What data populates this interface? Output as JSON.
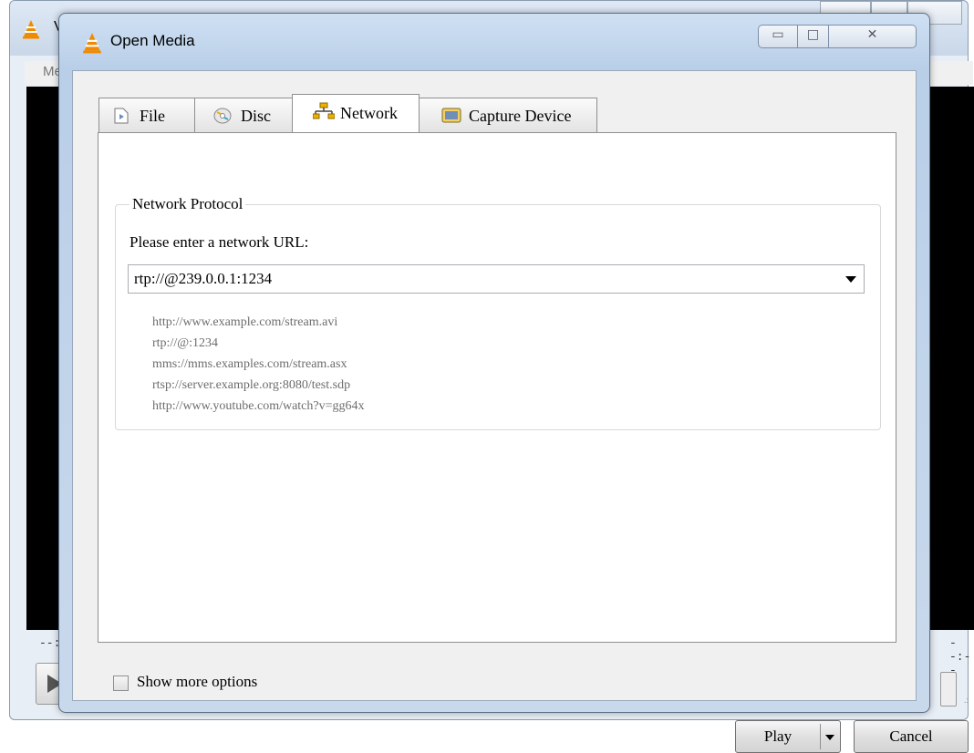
{
  "background_window": {
    "title": "V",
    "menu_label": "Me",
    "time_left": "--:--",
    "time_right": "--:--"
  },
  "dialog": {
    "title": "Open Media",
    "tabs": [
      {
        "label": "File",
        "icon": "file-icon"
      },
      {
        "label": "Disc",
        "icon": "disc-icon"
      },
      {
        "label": "Network",
        "icon": "network-icon",
        "active": true
      },
      {
        "label": "Capture Device",
        "icon": "capture-device-icon"
      }
    ],
    "network": {
      "group_title": "Network Protocol",
      "url_label": "Please enter a network URL:",
      "url_value": "rtp://@239.0.0.1:1234",
      "examples": [
        "http://www.example.com/stream.avi",
        "rtp://@:1234",
        "mms://mms.examples.com/stream.asx",
        "rtsp://server.example.org:8080/test.sdp",
        "http://www.youtube.com/watch?v=gg64x"
      ]
    },
    "footer": {
      "show_more_options_label": "Show more options",
      "show_more_options_checked": false,
      "play_label": "Play",
      "cancel_label": "Cancel"
    }
  },
  "colors": {
    "vlc_orange": "#f08a00",
    "titlebar_blue": "#c9d9ec"
  }
}
